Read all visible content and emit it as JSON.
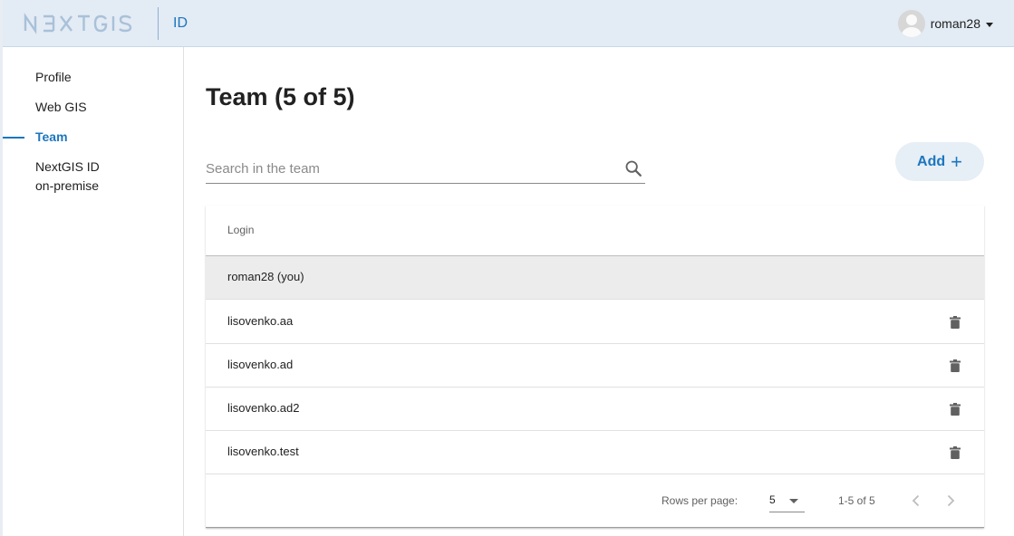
{
  "header": {
    "logo": "N3XTGIS",
    "app_label": "ID",
    "username": "roman28"
  },
  "sidebar": {
    "items": [
      {
        "label": "Profile"
      },
      {
        "label": "Web GIS"
      },
      {
        "label": "Team",
        "active": true
      },
      {
        "label_line1": "NextGIS ID",
        "label_line2": "on-premise"
      }
    ]
  },
  "main": {
    "title": "Team (5 of 5)",
    "search_placeholder": "Search in the team",
    "add_label": "Add",
    "add_icon": "+"
  },
  "table": {
    "column_login": "Login",
    "rows": [
      {
        "login": "roman28 (you)",
        "current": true
      },
      {
        "login": "lisovenko.aa"
      },
      {
        "login": "lisovenko.ad"
      },
      {
        "login": "lisovenko.ad2"
      },
      {
        "login": "lisovenko.test"
      }
    ],
    "rows_per_page_label": "Rows per page:",
    "rows_per_page": "5",
    "range": "1-5 of 5"
  },
  "colors": {
    "accent": "#1c76be",
    "header_bg": "#e3ebf4",
    "current_row_bg": "#ececec"
  },
  "icons": [
    "search-icon",
    "trash-icon",
    "chevron-left-icon",
    "chevron-right-icon",
    "caret-down-icon",
    "avatar-icon"
  ]
}
